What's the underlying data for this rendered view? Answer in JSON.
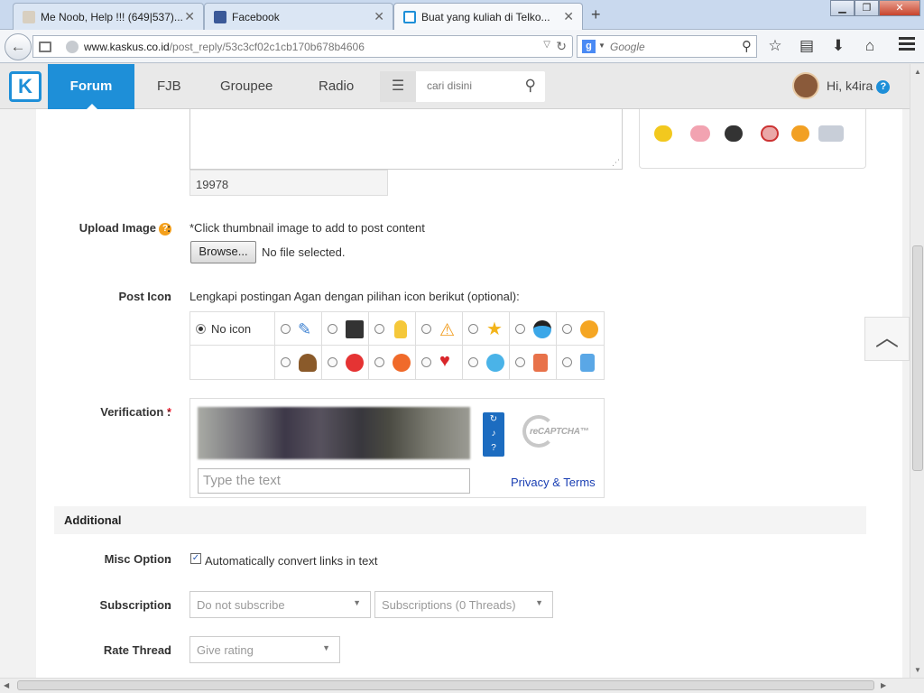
{
  "browser": {
    "tabs": [
      {
        "title": "Me Noob, Help !!! (649|537)..."
      },
      {
        "title": "Facebook"
      },
      {
        "title": "Buat yang kuliah di Telko..."
      }
    ],
    "url_domain": "www.kaskus.co.id",
    "url_path": "/post_reply/53c3cf02c1cb170b678b4606",
    "search_placeholder": "Google"
  },
  "site": {
    "logo": "K",
    "nav": [
      "Forum",
      "FJB",
      "Groupee",
      "Radio"
    ],
    "search_placeholder": "cari disini",
    "greeting": "Hi, k4ira",
    "help_mark": "?"
  },
  "form": {
    "char_count": "19978",
    "upload_label": "Upload Image",
    "upload_hint": "*Click thumbnail image to add to post content",
    "browse_label": "Browse...",
    "no_file": "No file selected.",
    "post_icon_label": "Post Icon",
    "post_icon_hint": "Lengkapi postingan Agan dengan pilihan icon berikut (optional):",
    "no_icon_label": "No icon",
    "verification_label": "Verification",
    "required_mark": "*",
    "captcha_placeholder": "Type the text",
    "recaptcha_text": "reCAPTCHA™",
    "privacy_link": "Privacy & Terms",
    "additional_heading": "Additional",
    "misc_label": "Misc Option",
    "misc_checkbox": "Automatically convert links in text",
    "subscription_label": "Subscription",
    "subscribe_select": "Do not subscribe",
    "subscriptions_select": "Subscriptions (0 Threads)",
    "rate_label": "Rate Thread",
    "rate_select": "Give rating",
    "colon": ":"
  }
}
